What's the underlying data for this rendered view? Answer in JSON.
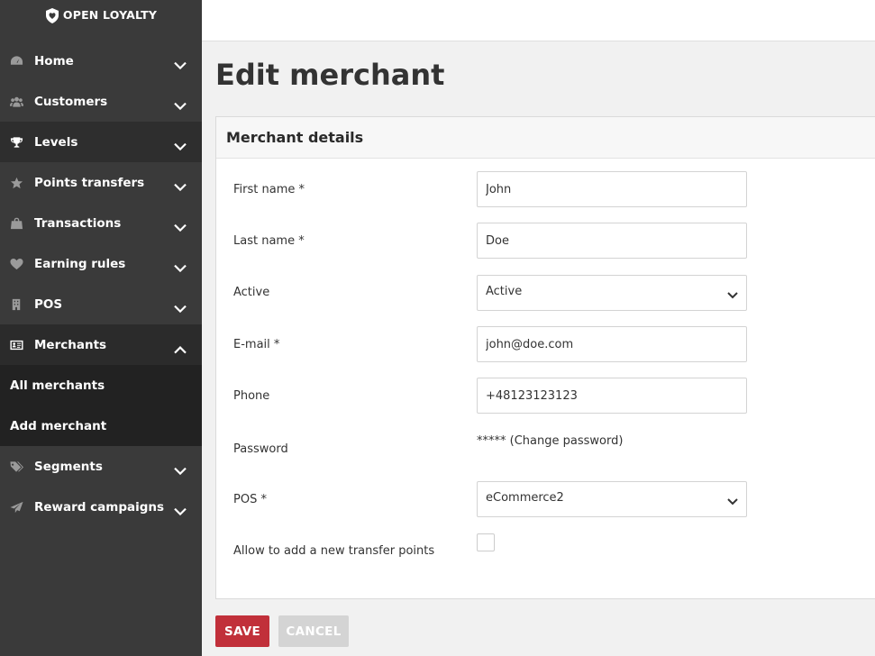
{
  "brand": {
    "name": "OPEN LOYALTY"
  },
  "sidebar": {
    "items": [
      {
        "label": "Home",
        "icon": "dashboard-icon"
      },
      {
        "label": "Customers",
        "icon": "users-icon"
      },
      {
        "label": "Levels",
        "icon": "trophy-icon"
      },
      {
        "label": "Points transfers",
        "icon": "star-icon"
      },
      {
        "label": "Transactions",
        "icon": "shopping-bag-icon"
      },
      {
        "label": "Earning rules",
        "icon": "heart-icon"
      },
      {
        "label": "POS",
        "icon": "building-icon"
      },
      {
        "label": "Merchants",
        "icon": "id-card-icon",
        "expanded": true
      },
      {
        "label": "Segments",
        "icon": "tags-icon"
      },
      {
        "label": "Reward campaigns",
        "icon": "paper-plane-icon"
      }
    ],
    "sub_items": [
      {
        "label": "All merchants"
      },
      {
        "label": "Add merchant"
      }
    ]
  },
  "page": {
    "title": "Edit merchant"
  },
  "form": {
    "section_title": "Merchant details",
    "first_name": {
      "label": "First name *",
      "value": "John"
    },
    "last_name": {
      "label": "Last name *",
      "value": "Doe"
    },
    "active": {
      "label": "Active",
      "value": "Active"
    },
    "email": {
      "label": "E-mail *",
      "value": "john@doe.com"
    },
    "phone": {
      "label": "Phone",
      "value": "+48123123123"
    },
    "password": {
      "label": "Password",
      "value": "***** (Change password)"
    },
    "pos": {
      "label": "POS *",
      "value": "eCommerce2"
    },
    "allow_transfer": {
      "label": "Allow to add a new transfer points",
      "checked": false
    }
  },
  "buttons": {
    "save": "SAVE",
    "cancel": "CANCEL"
  },
  "colors": {
    "sidebar_bg": "#3a3a3a",
    "save_bg": "#c1303a",
    "cancel_bg": "#d4d4d4"
  }
}
